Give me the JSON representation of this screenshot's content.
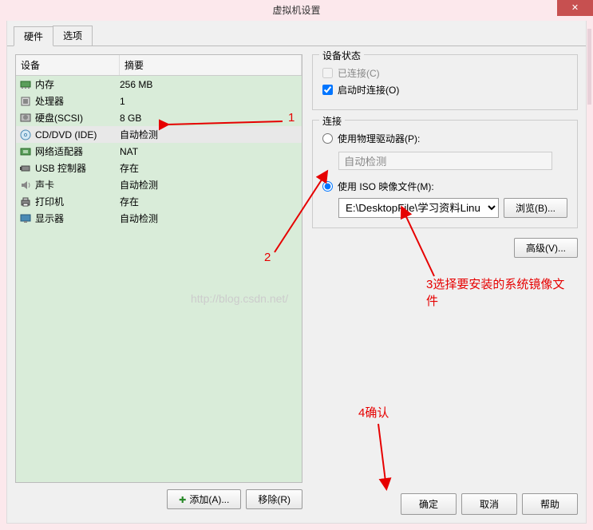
{
  "title": "虚拟机设置",
  "close": "✕",
  "tabs": {
    "hardware": "硬件",
    "options": "选项"
  },
  "listHeader": {
    "device": "设备",
    "summary": "摘要"
  },
  "devices": [
    {
      "icon": "memory",
      "name": "内存",
      "summary": "256 MB"
    },
    {
      "icon": "cpu",
      "name": "处理器",
      "summary": "1"
    },
    {
      "icon": "disk",
      "name": "硬盘(SCSI)",
      "summary": "8 GB"
    },
    {
      "icon": "cd",
      "name": "CD/DVD (IDE)",
      "summary": "自动检测",
      "selected": true
    },
    {
      "icon": "nic",
      "name": "网络适配器",
      "summary": "NAT"
    },
    {
      "icon": "usb",
      "name": "USB 控制器",
      "summary": "存在"
    },
    {
      "icon": "sound",
      "name": "声卡",
      "summary": "自动检测"
    },
    {
      "icon": "printer",
      "name": "打印机",
      "summary": "存在"
    },
    {
      "icon": "display",
      "name": "显示器",
      "summary": "自动检测"
    }
  ],
  "leftButtons": {
    "add": "添加(A)...",
    "remove": "移除(R)"
  },
  "status": {
    "legend": "设备状态",
    "connected": "已连接(C)",
    "connectAtPowerOn": "启动时连接(O)"
  },
  "connection": {
    "legend": "连接",
    "physical": "使用物理驱动器(P):",
    "physicalValue": "自动检测",
    "iso": "使用 ISO 映像文件(M):",
    "isoValue": "E:\\DesktopFile\\学习资料Linu",
    "browse": "浏览(B)..."
  },
  "advanced": "高级(V)...",
  "bottomButtons": {
    "ok": "确定",
    "cancel": "取消",
    "help": "帮助"
  },
  "annotations": {
    "one": "1",
    "two": "2",
    "three": "3选择要安装的系统镜像文件",
    "four": "4确认"
  },
  "watermark": "http://blog.csdn.net/"
}
